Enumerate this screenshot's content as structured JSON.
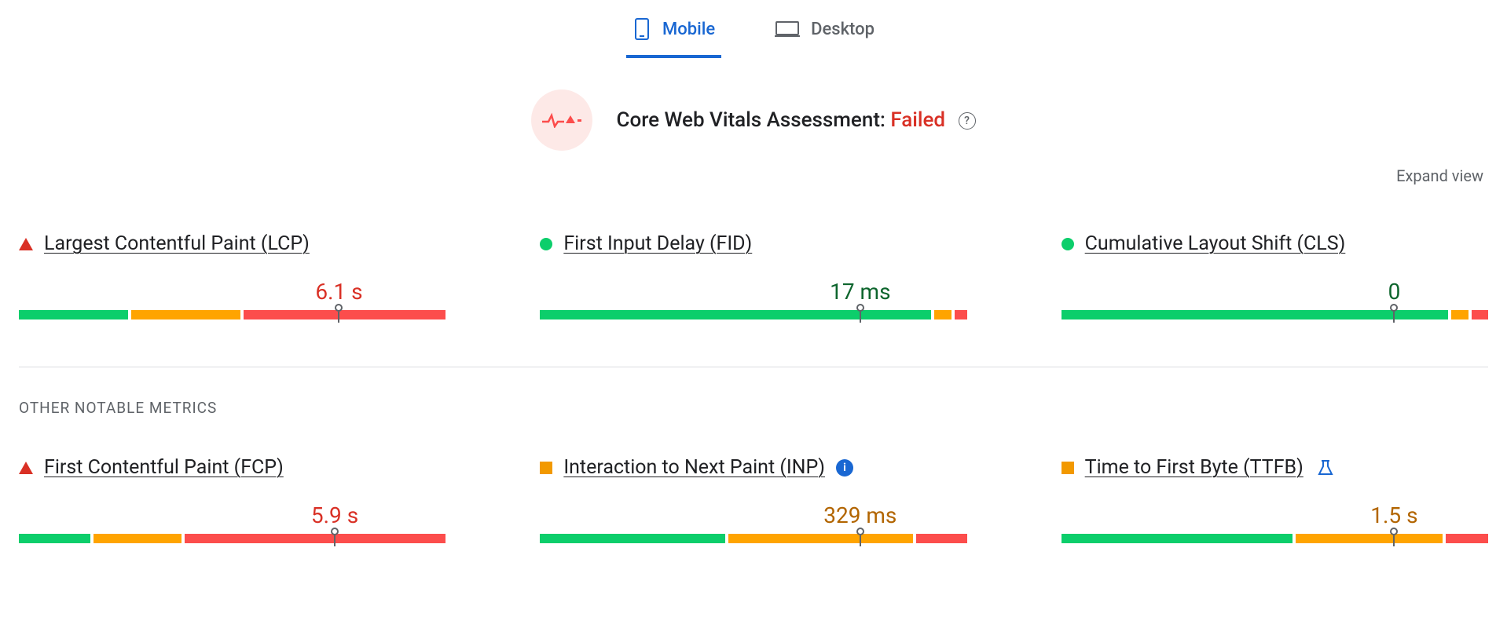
{
  "tabs": {
    "mobile": "Mobile",
    "desktop": "Desktop",
    "active": "mobile"
  },
  "assessment": {
    "label": "Core Web Vitals Assessment:",
    "status": "Failed"
  },
  "expand": "Expand view",
  "core_metrics": [
    {
      "id": "lcp",
      "title": "Largest Contentful Paint (LCP)",
      "value": "6.1 s",
      "status": "fail",
      "value_color": "red",
      "marker_pct": 75,
      "segments": [
        26,
        26,
        48
      ],
      "info": null
    },
    {
      "id": "fid",
      "title": "First Input Delay (FID)",
      "value": "17 ms",
      "status": "pass",
      "value_color": "green",
      "marker_pct": 75,
      "segments": [
        93,
        4,
        3
      ],
      "info": null
    },
    {
      "id": "cls",
      "title": "Cumulative Layout Shift (CLS)",
      "value": "0",
      "status": "pass",
      "value_color": "green",
      "marker_pct": 78,
      "segments": [
        92,
        4,
        4
      ],
      "info": null
    }
  ],
  "other_heading": "OTHER NOTABLE METRICS",
  "other_metrics": [
    {
      "id": "fcp",
      "title": "First Contentful Paint (FCP)",
      "value": "5.9 s",
      "status": "fail",
      "value_color": "red",
      "marker_pct": 74,
      "segments": [
        17,
        21,
        62
      ],
      "info": null
    },
    {
      "id": "inp",
      "title": "Interaction to Next Paint (INP)",
      "value": "329 ms",
      "status": "warn",
      "value_color": "amber",
      "marker_pct": 75,
      "segments": [
        44,
        44,
        12
      ],
      "info": "info"
    },
    {
      "id": "ttfb",
      "title": "Time to First Byte (TTFB)",
      "value": "1.5 s",
      "status": "warn",
      "value_color": "amber",
      "marker_pct": 78,
      "segments": [
        55,
        35,
        10
      ],
      "info": "flask"
    }
  ]
}
